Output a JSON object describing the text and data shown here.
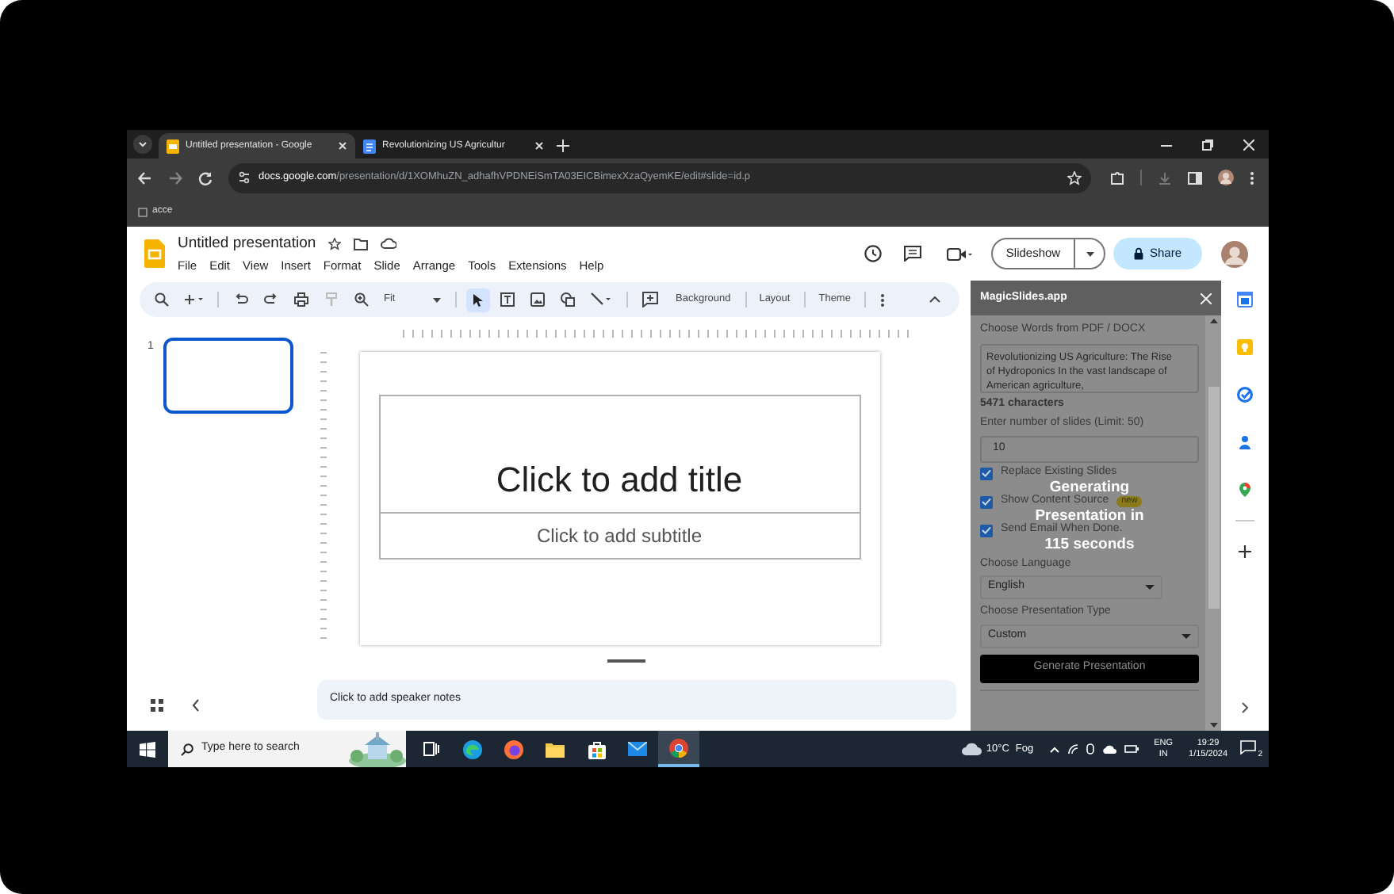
{
  "browser": {
    "tabs": [
      {
        "title": "Untitled presentation - Google",
        "selected": true
      },
      {
        "title": "Revolutionizing US Agricultur",
        "selected": false
      }
    ],
    "address": {
      "domain": "docs.google.com",
      "path": "/presentation/d/1XOMhuZN_adhafhVPDNEiSmTA03EICBimexXzaQyemKE/edit#slide=id.p"
    },
    "bookmarks": [
      {
        "label": "acce"
      }
    ]
  },
  "docs": {
    "title": "Untitled presentation",
    "menu": [
      "File",
      "Edit",
      "View",
      "Insert",
      "Format",
      "Slide",
      "Arrange",
      "Tools",
      "Extensions",
      "Help"
    ],
    "toolbar": {
      "zoom": "Fit",
      "pointer_selected": true,
      "buttons": [
        "Background",
        "Layout",
        "Theme"
      ]
    },
    "slideshow": "Slideshow",
    "share": "Share"
  },
  "filmstrip": [
    {
      "number": "1",
      "selected": true
    }
  ],
  "slide": {
    "title_placeholder": "Click to add title",
    "subtitle_placeholder": "Click to add subtitle"
  },
  "notes_placeholder": "Click to add speaker notes",
  "panel": {
    "title": "MagicSlides.app",
    "source_label": "Choose Words from PDF / DOCX",
    "source_text": "Revolutionizing US Agriculture: The Rise of Hydroponics In the vast landscape of American agriculture,",
    "char_count": "5471 characters",
    "slides_label": "Enter number of slides (Limit: 50)",
    "slides_value": "10",
    "options": [
      {
        "label": "Replace Existing Slides",
        "checked": true
      },
      {
        "label": "Show Content Source",
        "checked": true,
        "badge": "new"
      },
      {
        "label": "Send Email When Done.",
        "checked": true
      }
    ],
    "language_label": "Choose Language",
    "language": "English",
    "type_label": "Choose Presentation Type",
    "type": "Custom",
    "generate": "Generate Presentation",
    "overlay_lines": [
      "Generating",
      "Presentation in",
      "115 seconds"
    ]
  },
  "taskbar": {
    "search_placeholder": "Type here to search",
    "apps": [
      {
        "kind": "taskview",
        "active": false
      },
      {
        "kind": "edge",
        "active": false
      },
      {
        "kind": "firefox",
        "active": false
      },
      {
        "kind": "files",
        "active": false
      },
      {
        "kind": "store",
        "active": false
      },
      {
        "kind": "mail",
        "active": false
      },
      {
        "kind": "chrome",
        "active": true
      }
    ],
    "weather": {
      "temp": "10°C",
      "condition": "Fog"
    },
    "language": "ENG",
    "region": "IN",
    "time": "19:29",
    "date": "1/15/2024",
    "notifications": "2"
  }
}
